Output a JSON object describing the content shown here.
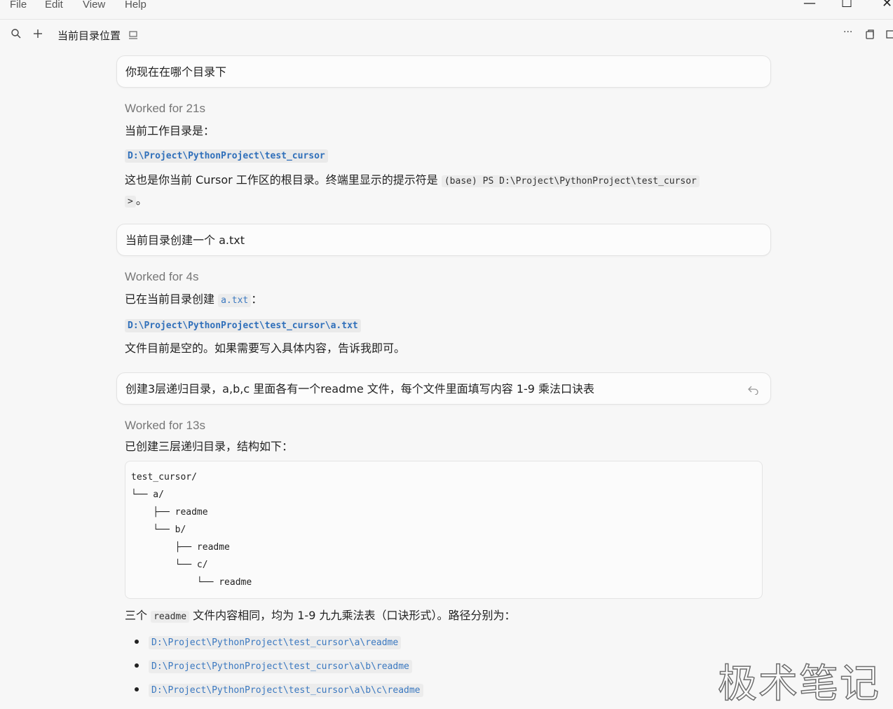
{
  "menu": {
    "items": [
      "File",
      "Edit",
      "View",
      "Help"
    ]
  },
  "window_controls": {
    "minimize": "—",
    "maximize": "☐",
    "close": "✕"
  },
  "toolbar": {
    "title": "当前目录位置",
    "more": "···"
  },
  "conversation": [
    {
      "user": "你现在在哪个目录下",
      "worked": "Worked for 21s",
      "heading": "当前工作目录是：",
      "path": "D:\\Project\\PythonProject\\test_cursor",
      "note_pre": "这也是你当前 Cursor 工作区的根目录。终端里显示的提示符是 ",
      "note_code1": "(base) PS D:\\Project\\PythonProject\\test_cursor",
      "note_code2": ">",
      "note_post": "。"
    },
    {
      "user": "当前目录创建一个 a.txt",
      "worked": "Worked for 4s",
      "heading_pre": "已在当前目录创建 ",
      "heading_code": "a.txt",
      "heading_post": "：",
      "path": "D:\\Project\\PythonProject\\test_cursor\\a.txt",
      "note": "文件目前是空的。如果需要写入具体内容，告诉我即可。"
    },
    {
      "user": "创建3层递归目录，a,b,c 里面各有一个readme 文件，每个文件里面填写内容 1-9 乘法口诀表",
      "worked": "Worked for 13s",
      "heading": "已创建三层递归目录，结构如下：",
      "tree": [
        "test_cursor/",
        "└── a/",
        "    ├── readme",
        "    └── b/",
        "        ├── readme",
        "        └── c/",
        "            └── readme"
      ],
      "summary_pre": "三个 ",
      "summary_code": "readme",
      "summary_post": " 文件内容相同，均为 1-9 九九乘法表（口诀形式）。路径分别为：",
      "paths": [
        "D:\\Project\\PythonProject\\test_cursor\\a\\readme",
        "D:\\Project\\PythonProject\\test_cursor\\a\\b\\readme",
        "D:\\Project\\PythonProject\\test_cursor\\a\\b\\c\\readme"
      ]
    }
  ],
  "watermark": "极术笔记"
}
